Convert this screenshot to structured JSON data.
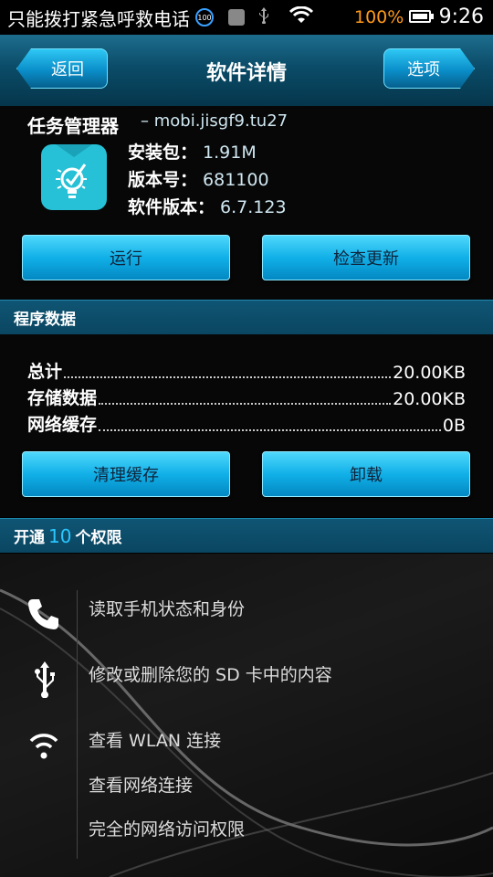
{
  "status_bar": {
    "title": "只能拨打紧急呼救电话",
    "badge": "100",
    "battery_percent": "100%",
    "time": "9:26"
  },
  "header": {
    "title": "软件详情",
    "back_label": "返回",
    "options_label": "选项"
  },
  "app": {
    "name": "任务管理器",
    "package": "– mobi.jisgf9.tu27",
    "icon": "task-manager-icon",
    "install_size_key": "安装包：",
    "install_size": "1.91M",
    "version_code_key": "版本号：",
    "version_code": "681100",
    "version_name_key": "软件版本：",
    "version_name": "6.7.123",
    "run_label": "运行",
    "check_update_label": "检查更新"
  },
  "program_data": {
    "header": "程序数据",
    "rows": [
      {
        "label": "总计",
        "value": "20.00KB"
      },
      {
        "label": "存储数据",
        "value": "20.00KB"
      },
      {
        "label": "网络缓存",
        "value": "0B"
      }
    ],
    "clear_cache_label": "清理缓存",
    "uninstall_label": "卸载"
  },
  "permissions": {
    "header_prefix": "开通",
    "count": "10",
    "header_suffix": "个权限",
    "items": [
      {
        "label": "读取手机状态和身份",
        "icon": "phone-icon"
      },
      {
        "label": "修改或删除您的 SD 卡中的内容",
        "icon": "usb-icon"
      },
      {
        "label": "查看 WLAN 连接",
        "icon": "wifi-icon"
      },
      {
        "label": "查看网络连接",
        "icon": ""
      },
      {
        "label": "完全的网络访问权限",
        "icon": ""
      }
    ]
  },
  "colors": {
    "accent": "#11b0e8",
    "battery_text": "#ff9a1a",
    "header_bg": "#0a4661",
    "count_text": "#2ac6ff"
  }
}
